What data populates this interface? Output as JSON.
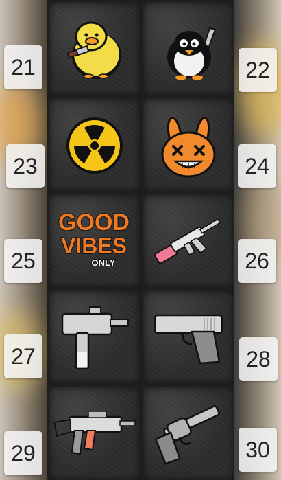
{
  "items": [
    {
      "number": "21",
      "icon": "duck-with-knife-icon"
    },
    {
      "number": "22",
      "icon": "penguin-with-knife-icon"
    },
    {
      "number": "23",
      "icon": "radiation-symbol-icon"
    },
    {
      "number": "24",
      "icon": "bunny-face-icon"
    },
    {
      "number": "25",
      "icon": "good-vibes-text-icon",
      "art_text": [
        "GOOD",
        "VIBES",
        "ONLY"
      ]
    },
    {
      "number": "26",
      "icon": "rifle-icon"
    },
    {
      "number": "27",
      "icon": "submachine-gun-icon"
    },
    {
      "number": "28",
      "icon": "pistol-icon"
    },
    {
      "number": "29",
      "icon": "assault-rifle-icon"
    },
    {
      "number": "30",
      "icon": "revolver-icon"
    }
  ],
  "colors": {
    "duck": "#f2dc48",
    "radiation": "#f5c518",
    "bunny": "#f08a2c",
    "vibes": "#f07a24",
    "pink": "#f07a93",
    "label_bg": "#f2f2f2"
  }
}
